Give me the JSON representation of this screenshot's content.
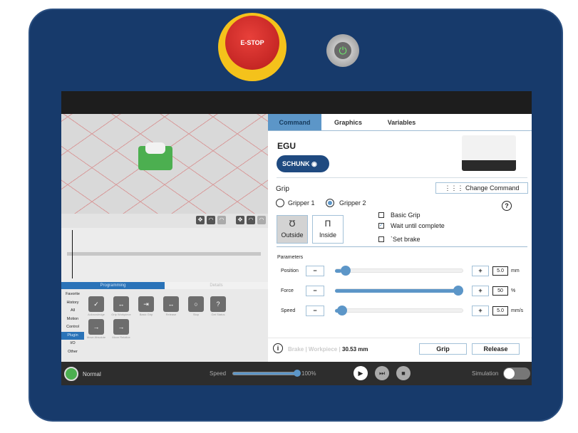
{
  "hardware": {
    "estop_label": "E-STOP",
    "power_icon": "power-icon"
  },
  "left": {
    "tabs": [
      "Programming",
      "Details"
    ],
    "categories": [
      "Favorite",
      "History",
      "All",
      "Motion",
      "Control",
      "Plugin",
      "I/O",
      "Other"
    ],
    "selected_category": "Plugin",
    "nodes": [
      "Acknowledge",
      "Grip Workpiece",
      "Basic Grip",
      "Release",
      "Stop",
      "Get Status",
      "Move Absolute",
      "Move Relative"
    ]
  },
  "right": {
    "tabs": [
      "Command",
      "Graphics",
      "Variables"
    ],
    "active_tab": "Command",
    "product": "EGU",
    "brand": "SCHUNK",
    "section": "Grip",
    "change_command": "Change Command",
    "gripper1": "Gripper 1",
    "gripper2": "Gripper 2",
    "selected_gripper": "Gripper 2",
    "outside": "Outside",
    "inside": "Inside",
    "selected_mode": "Outside",
    "basic_grip": {
      "label": "Basic Grip",
      "checked": false
    },
    "wait": {
      "label": "Wait until complete",
      "checked": true
    },
    "brake": {
      "label": "`Set brake",
      "checked": false
    },
    "params_title": "Parameters",
    "params": [
      {
        "label": "Position",
        "value": "5.0",
        "unit": "mm",
        "fraction": 0.05
      },
      {
        "label": "Force",
        "value": "50",
        "unit": "%",
        "fraction": 1.0
      },
      {
        "label": "Speed",
        "value": "5.0",
        "unit": "mm/s",
        "fraction": 0.02
      }
    ],
    "status_dim": "Brake | Workpiece |",
    "status_value": "30.53 mm",
    "grip_btn": "Grip",
    "release_btn": "Release"
  },
  "bottom": {
    "status": "Normal",
    "speed_label": "Speed",
    "speed_value": "100%",
    "speed_fraction": 1.0,
    "simulation": "Simulation",
    "simulation_on": false
  },
  "colors": {
    "frame": "#173a6b",
    "accent": "#5c96c8",
    "status_ok": "#4caf50"
  }
}
